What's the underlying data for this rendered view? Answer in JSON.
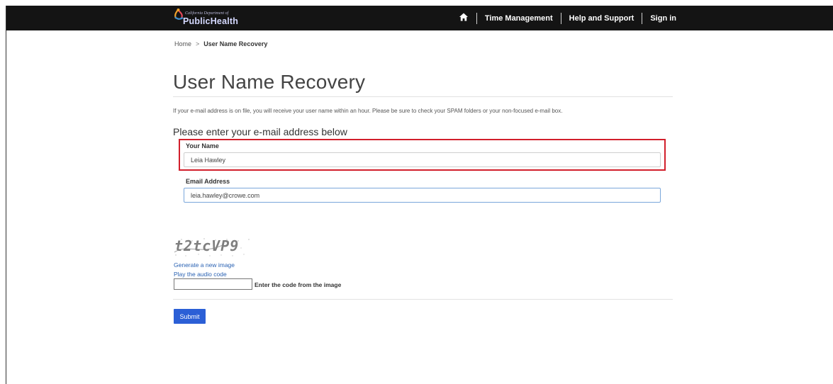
{
  "header": {
    "logo_top": "California Department of",
    "logo_main": "PublicHealth",
    "home_icon": "home-icon",
    "nav": [
      "Time Management",
      "Help and Support",
      "Sign in"
    ]
  },
  "breadcrumb": {
    "home": "Home",
    "separator": ">",
    "current": "User Name Recovery"
  },
  "page": {
    "title": "User Name Recovery",
    "info": "If your e-mail address is on file, you will receive your user name within an hour. Please be sure to check your SPAM folders or your non-focused e-mail box.",
    "subtitle": "Please enter your e-mail address below"
  },
  "form": {
    "name_label": "Your Name",
    "name_value": "Leia Hawley",
    "email_label": "Email Address",
    "email_value": "leia.hawley@crowe.com",
    "captcha_text": "t2tcVP9",
    "captcha_new_link": "Generate a new image",
    "captcha_audio_link": "Play the audio code",
    "code_value": "",
    "code_label": "Enter the code from the image",
    "submit_label": "Submit"
  },
  "colors": {
    "topbar": "#141414",
    "highlight": "#d21f2b",
    "link": "#2a62b3",
    "submit": "#2b5fd6"
  }
}
